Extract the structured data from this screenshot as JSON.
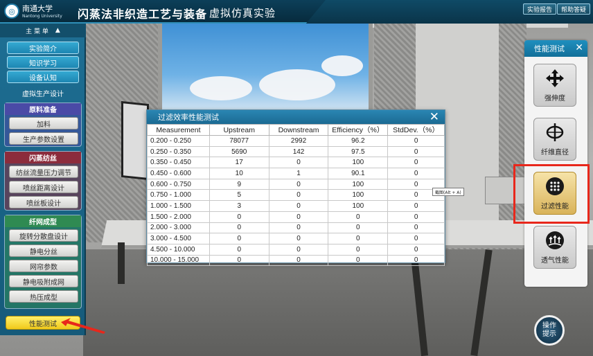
{
  "header": {
    "school_name": "南通大学",
    "school_name_en": "Nantong University",
    "title": "闪蒸法非织造工艺与装备",
    "subtitle": "虚拟仿真实验",
    "report_button": "实验报告",
    "help_button": "帮助答疑"
  },
  "sidebar": {
    "menu_label": "主 菜 单",
    "menu_toggle": "▲",
    "top_items": [
      {
        "label": "实验简介"
      },
      {
        "label": "知识学习"
      },
      {
        "label": "设备认知"
      }
    ],
    "virtual_design_label": "虚拟生产设计",
    "sections": [
      {
        "title": "原料准备",
        "color": "#4a4aa6",
        "items": [
          "加料",
          "生产参数设置"
        ]
      },
      {
        "title": "闪蒸纺丝",
        "color": "#8c2c3c",
        "items": [
          "纺丝流量压力调节",
          "喷丝距离设计",
          "喷丝板设计"
        ]
      },
      {
        "title": "纤网成型",
        "color": "#2f8a52",
        "items": [
          "旋转分散盘设计",
          "静电分丝",
          "网帘参数",
          "静电吸附成网",
          "热压成型"
        ]
      }
    ],
    "performance_button": "性能测试"
  },
  "right_panel": {
    "title": "性能测试",
    "close": "✕",
    "tools": [
      {
        "label": "强伸度",
        "icon": "move-arrows-icon",
        "active": false
      },
      {
        "label": "纤维直径",
        "icon": "diameter-icon",
        "active": false
      },
      {
        "label": "过滤性能",
        "icon": "filter-dots-icon",
        "active": true
      },
      {
        "label": "透气性能",
        "icon": "airflow-icon",
        "active": false
      }
    ]
  },
  "help_circle": {
    "line1": "操作",
    "line2": "提示"
  },
  "tooltip": "截图(Alt + A)",
  "modal": {
    "title": "过滤效率性能测试",
    "close": "✕",
    "columns": [
      "Measurement",
      "Upstream",
      "Downstream",
      "Efficiency（%）",
      "StdDev.（%）"
    ],
    "rows": [
      [
        "0.200 - 0.250",
        "78077",
        "2992",
        "96.2",
        "0"
      ],
      [
        "0.250 - 0.350",
        "5690",
        "142",
        "97.5",
        "0"
      ],
      [
        "0.350 - 0.450",
        "17",
        "0",
        "100",
        "0"
      ],
      [
        "0.450 - 0.600",
        "10",
        "1",
        "90.1",
        "0"
      ],
      [
        "0.600 - 0.750",
        "9",
        "0",
        "100",
        "0"
      ],
      [
        "0.750 - 1.000",
        "5",
        "0",
        "100",
        "0"
      ],
      [
        "1.000 - 1.500",
        "3",
        "0",
        "100",
        "0"
      ],
      [
        "1.500 - 2.000",
        "0",
        "0",
        "0",
        "0"
      ],
      [
        "2.000 - 3.000",
        "0",
        "0",
        "0",
        "0"
      ],
      [
        "3.000 - 4.500",
        "0",
        "0",
        "0",
        "0"
      ],
      [
        "4.500 - 10.000",
        "0",
        "0",
        "0",
        "0"
      ],
      [
        "10.000 - 15.000",
        "0",
        "0",
        "0",
        "0"
      ]
    ]
  }
}
